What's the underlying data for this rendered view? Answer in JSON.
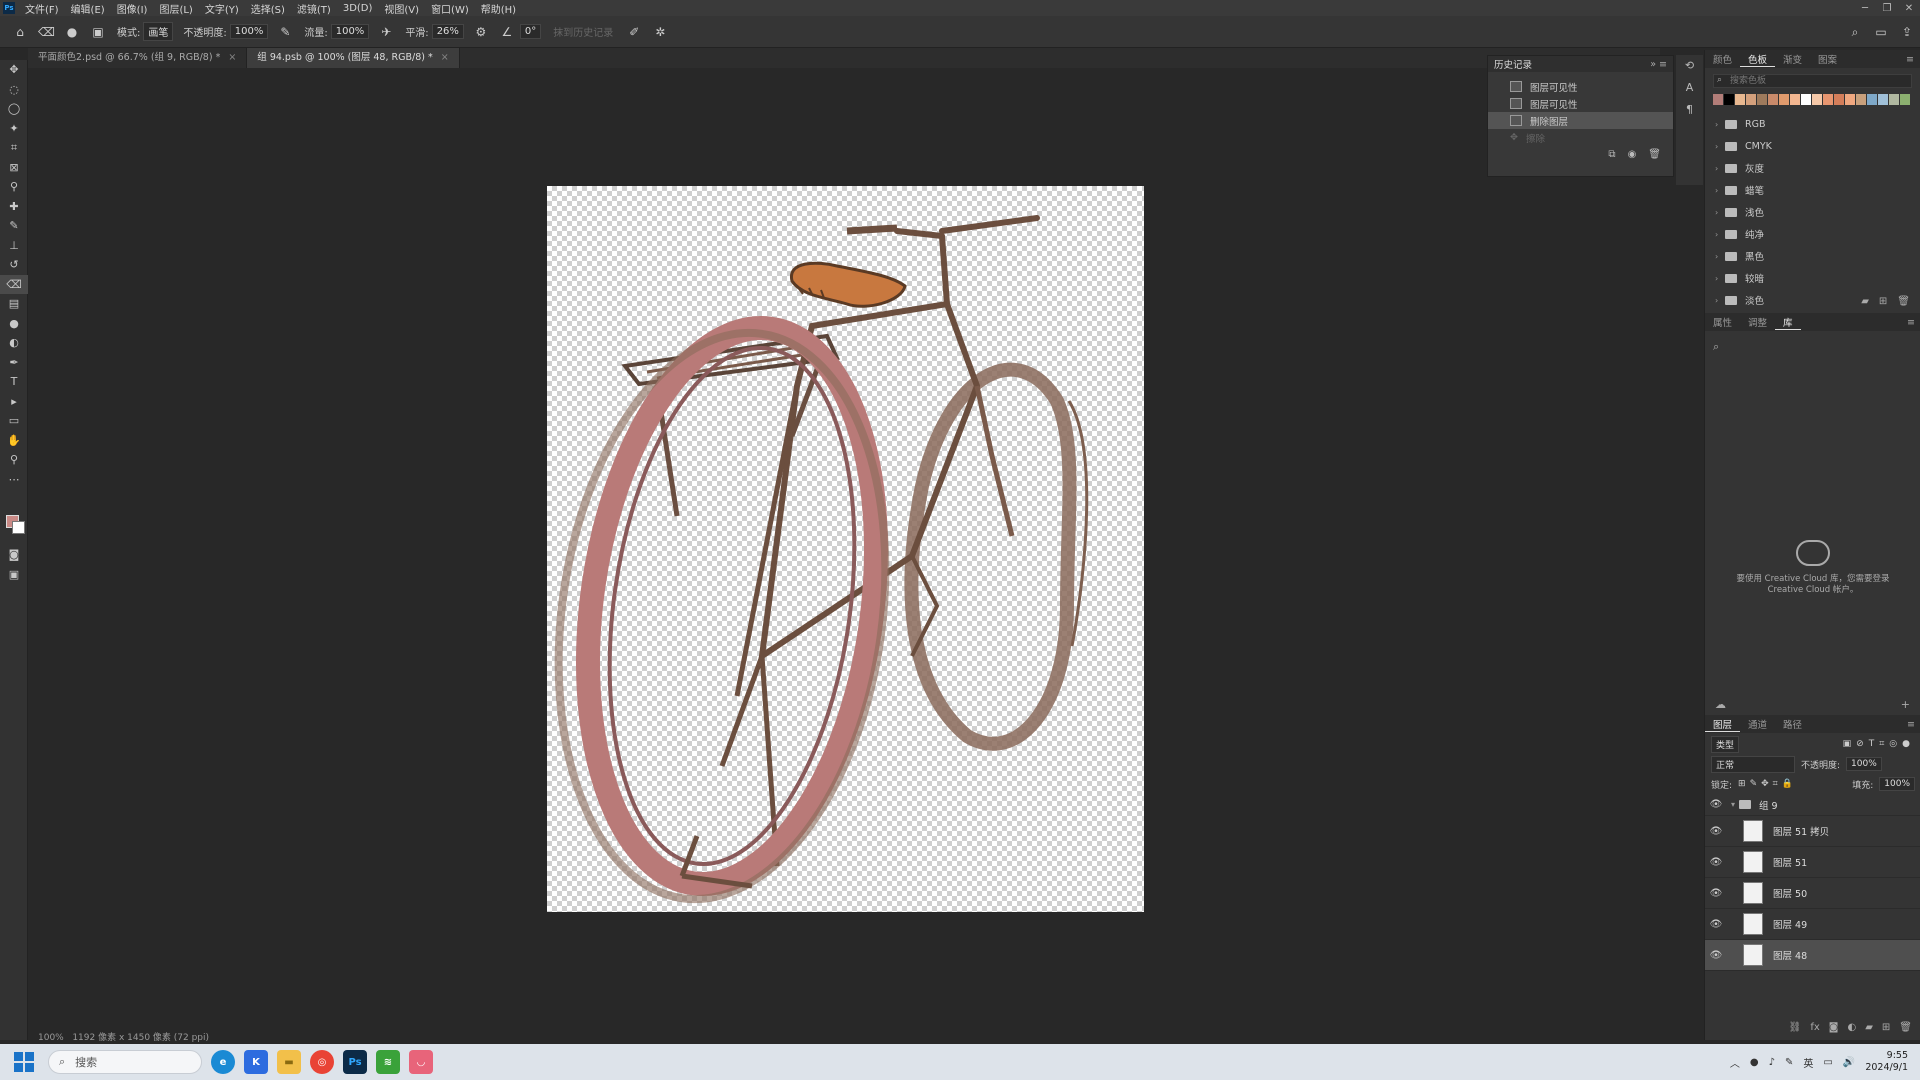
{
  "menubar": {
    "logo": "Ps",
    "items": [
      "文件(F)",
      "编辑(E)",
      "图像(I)",
      "图层(L)",
      "文字(Y)",
      "选择(S)",
      "滤镜(T)",
      "3D(D)",
      "视图(V)",
      "窗口(W)",
      "帮助(H)"
    ]
  },
  "options": {
    "mode_label": "模式:",
    "mode_value": "画笔",
    "opacity_label": "不透明度:",
    "opacity_value": "100%",
    "flow_label": "流量:",
    "flow_value": "100%",
    "smooth_label": "平滑:",
    "smooth_value": "26%",
    "angle_value": "0°",
    "erase_history": "抹到历史记录"
  },
  "tabs": [
    {
      "label": "平面颜色2.psd @ 66.7% (组 9, RGB/8) *",
      "active": false
    },
    {
      "label": "组 94.psb @ 100% (图层 48, RGB/8) *",
      "active": true
    }
  ],
  "status": {
    "zoom": "100%",
    "doc_info": "1192 像素 x 1450 像素 (72 ppi)"
  },
  "history": {
    "title": "历史记录",
    "items": [
      "图层可见性",
      "图层可见性",
      "删除图层",
      "擦除"
    ]
  },
  "swatches_panel": {
    "tabs": [
      "颜色",
      "色板",
      "渐变",
      "图案"
    ],
    "search_placeholder": "搜索色板",
    "colors": [
      "#b27d78",
      "#000000",
      "#e8b890",
      "#d4a07c",
      "#9e7a5c",
      "#c98a6a",
      "#e09a6c",
      "#f2b690",
      "#ffffff",
      "#f5c8a8",
      "#e89670",
      "#d47e5a",
      "#f0a880",
      "#c8a07c",
      "#7ea8c8",
      "#a0c0d8",
      "#b0b8a0",
      "#8cb070"
    ],
    "groups": [
      "RGB",
      "CMYK",
      "灰度",
      "蜡笔",
      "浅色",
      "纯净",
      "黑色",
      "较暗",
      "淡色"
    ]
  },
  "library_panel": {
    "tabs": [
      "属性",
      "调整",
      "库"
    ],
    "message_line1": "要使用 Creative Cloud 库，您需要登录",
    "message_line2": "Creative Cloud 帐户。"
  },
  "layers_panel": {
    "tabs": [
      "图层",
      "通道",
      "路径"
    ],
    "filter_label": "类型",
    "blend_mode": "正常",
    "opacity_label": "不透明度:",
    "opacity_value": "100%",
    "lock_label": "锁定:",
    "fill_label": "填充:",
    "fill_value": "100%",
    "group_name": "组 9",
    "layers": [
      "图层 51 拷贝",
      "图层 51",
      "图层 50",
      "图层 49",
      "图层 48"
    ]
  },
  "taskbar": {
    "search_placeholder": "搜索",
    "time": "9:55",
    "date": "2024/9/1",
    "ime": "英"
  }
}
